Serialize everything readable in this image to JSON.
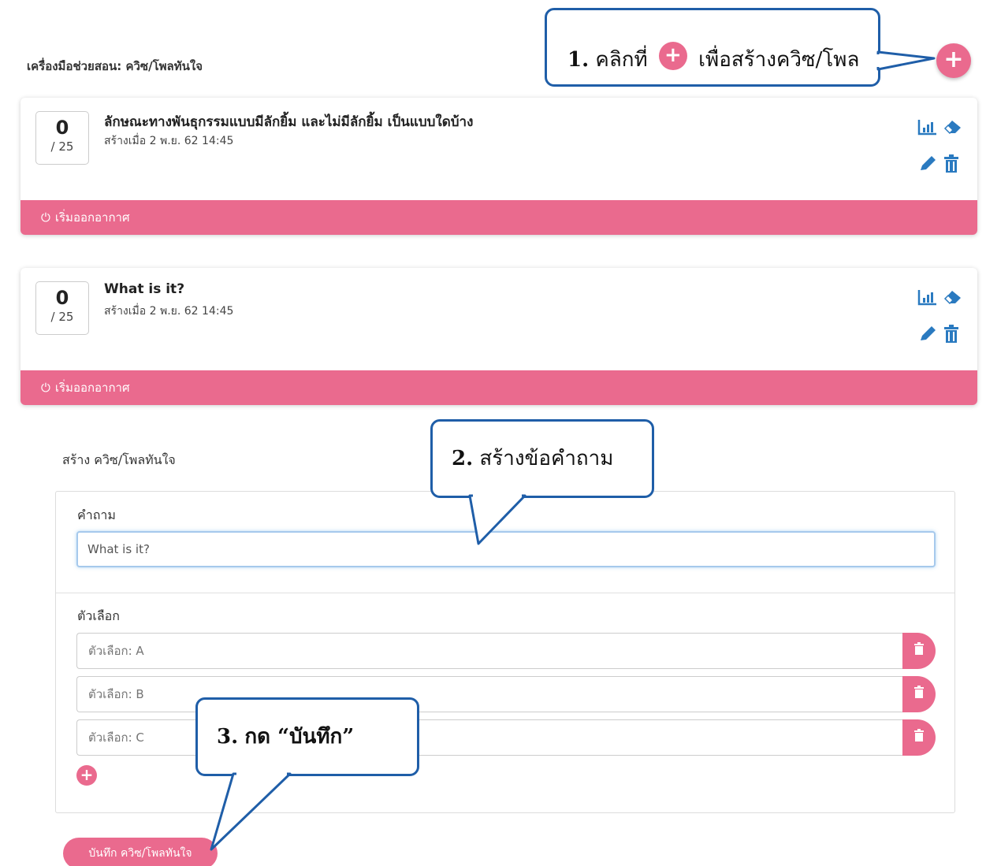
{
  "header": {
    "title": "เครื่องมือช่วยสอน: ควิซ/โพลทันใจ",
    "add_button_icon": "plus-icon"
  },
  "quizzes": [
    {
      "count": "0",
      "total": "/ 25",
      "question": "ลักษณะทางพันธุกรรมแบบมีลักยิ้ม และไม่มีลักยิ้ม เป็นแบบใดบ้าง",
      "created": "สร้างเมื่อ 2 พ.ย. 62 14:45",
      "footer_label": "เริ่มออกอากาศ"
    },
    {
      "count": "0",
      "total": "/ 25",
      "question": "What is it?",
      "created": "สร้างเมื่อ 2 พ.ย. 62 14:45",
      "footer_label": "เริ่มออกอากาศ"
    }
  ],
  "form": {
    "title": "สร้าง ควิซ/โพลทันใจ",
    "question_label": "คำถาม",
    "question_value": "What is it?",
    "choices_label": "ตัวเลือก",
    "choices": [
      {
        "placeholder": "ตัวเลือก: A"
      },
      {
        "placeholder": "ตัวเลือก: B"
      },
      {
        "placeholder": "ตัวเลือก: C"
      }
    ],
    "save_label": "บันทึก ควิซ/โพลทันใจ"
  },
  "callouts": {
    "step1_num": "1.",
    "step1_pre": "คลิกที่",
    "step1_post": "เพื่อสร้างควิซ/โพล",
    "step2_num": "2.",
    "step2_text": "สร้างข้อคำถาม",
    "step3_num": "3.",
    "step3_text": "กด “บันทึก”"
  },
  "colors": {
    "accent": "#ea6a8e",
    "icon_blue": "#2a7ac0",
    "callout_border": "#1f5ea8"
  }
}
